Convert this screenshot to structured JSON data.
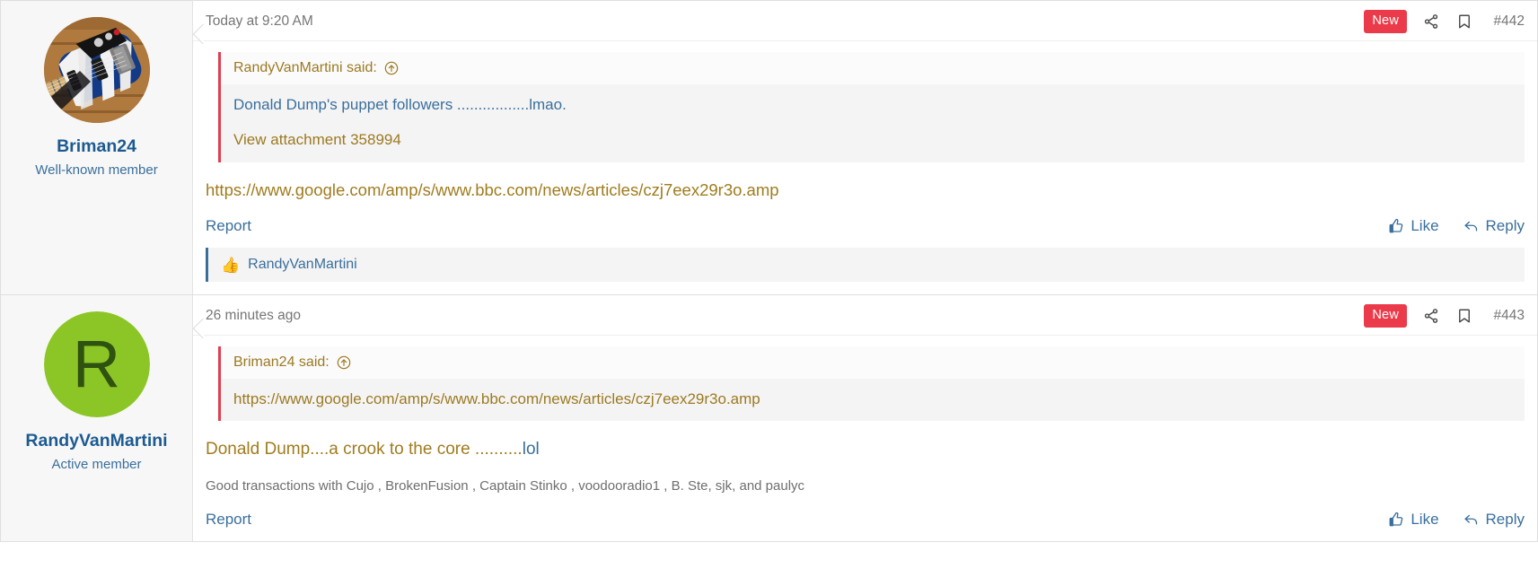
{
  "posts": [
    {
      "user": {
        "name": "Briman24",
        "title": "Well-known member",
        "avatar_type": "image",
        "avatar_alt": "blue-and-white-striped-electric-guitar-on-wood-floor"
      },
      "timestamp": "Today at 9:20 AM",
      "badge": "New",
      "post_number": "#442",
      "quote": {
        "attribution": "RandyVanMartini said:",
        "lines": [
          {
            "text": "Donald Dump's puppet followers .................lmao.",
            "color": "blue"
          },
          {
            "text": "View attachment 358994",
            "color": "amber"
          }
        ]
      },
      "body_link": "https://www.google.com/amp/s/www.bbc.com/news/articles/czj7eex29r3o.amp",
      "report_label": "Report",
      "like_label": "Like",
      "reply_label": "Reply",
      "reactions": {
        "emoji": "👍",
        "names": "RandyVanMartini"
      }
    },
    {
      "user": {
        "name": "RandyVanMartini",
        "title": "Active member",
        "avatar_type": "letter",
        "avatar_letter": "R",
        "avatar_bg": "#8cc626",
        "avatar_fg": "#2f5210"
      },
      "timestamp": "26 minutes ago",
      "badge": "New",
      "post_number": "#443",
      "quote": {
        "attribution": "Briman24 said:",
        "lines": [
          {
            "text": "https://www.google.com/amp/s/www.bbc.com/news/articles/czj7eex29r3o.amp",
            "color": "amber"
          }
        ]
      },
      "body_text_main": "Donald Dump....a crook to the core ..........",
      "body_text_link": "lol",
      "signature": "Good transactions with Cujo , BrokenFusion , Captain Stinko , voodooradio1 , B. Ste, sjk, and paulyc",
      "report_label": "Report",
      "like_label": "Like",
      "reply_label": "Reply"
    }
  ],
  "colors": {
    "badge_new": "#eb3b4a",
    "quote_bar": "#e03e52",
    "link_blue": "#3a6f9c",
    "link_amber": "#a07c1e"
  },
  "icons": {
    "share": "share-icon",
    "bookmark": "bookmark-icon",
    "jump_to_quote": "arrow-up-circle-icon",
    "like": "thumbs-up-icon",
    "reply": "reply-arrow-icon"
  }
}
